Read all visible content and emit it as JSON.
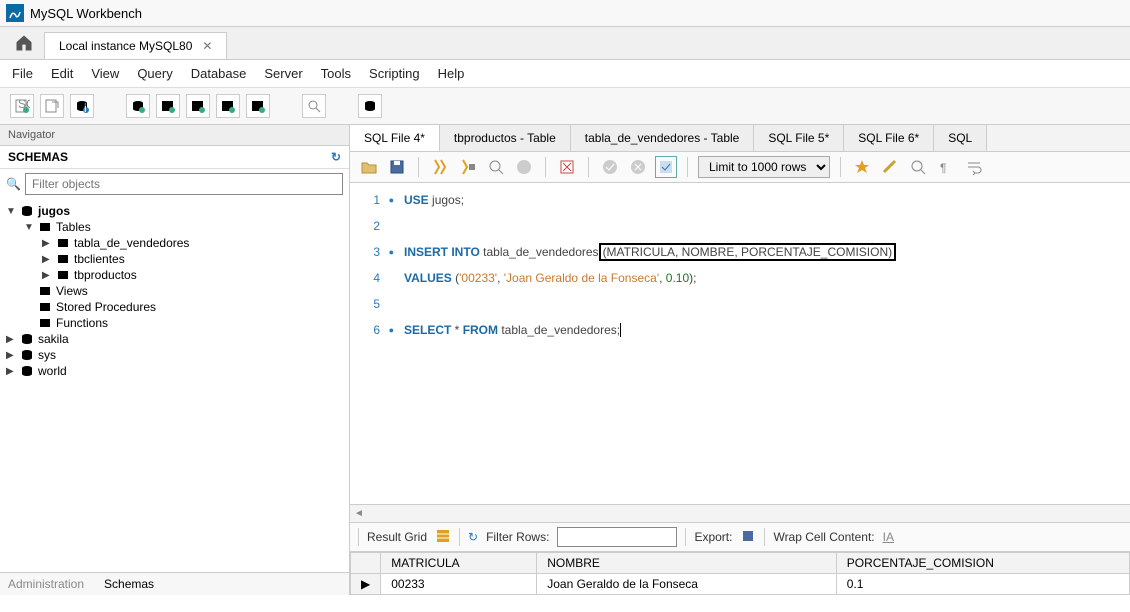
{
  "app_title": "MySQL Workbench",
  "connection_tab": "Local instance MySQL80",
  "menu": [
    "File",
    "Edit",
    "View",
    "Query",
    "Database",
    "Server",
    "Tools",
    "Scripting",
    "Help"
  ],
  "navigator_label": "Navigator",
  "schemas_label": "SCHEMAS",
  "filter_placeholder": "Filter objects",
  "tree": {
    "jugos": "jugos",
    "tables": "Tables",
    "tabla_de_vendedores": "tabla_de_vendedores",
    "tbclientes": "tbclientes",
    "tbproductos": "tbproductos",
    "views": "Views",
    "stored_procedures": "Stored Procedures",
    "functions": "Functions",
    "sakila": "sakila",
    "sys": "sys",
    "world": "world"
  },
  "nav_footer": [
    "Administration",
    "Schemas"
  ],
  "query_tabs": [
    "SQL File 4*",
    "tbproductos - Table",
    "tabla_de_vendedores - Table",
    "SQL File 5*",
    "SQL File 6*",
    "SQL"
  ],
  "limit_label": "Limit to 1000 rows",
  "code": {
    "l1_a": "USE",
    "l1_b": " jugos;",
    "l3_a": "INSERT INTO",
    "l3_b": " tabla_de_vendedores",
    "l3_c": "(MATRICULA, NOMBRE, PORCENTAJE_COMISION)",
    "l4_a": "VALUES",
    "l4_b": " (",
    "l4_c": "'00233'",
    "l4_d": ", ",
    "l4_e": "'Joan Geraldo de la Fonseca'",
    "l4_f": ", ",
    "l4_g": "0.10",
    "l4_h": ");",
    "l6_a": "SELECT",
    "l6_b": " * ",
    "l6_c": "FROM",
    "l6_d": " tabla_de_vendedores;"
  },
  "line_numbers": [
    "1",
    "2",
    "3",
    "4",
    "5",
    "6"
  ],
  "result_grid_label": "Result Grid",
  "filter_rows_label": "Filter Rows:",
  "export_label": "Export:",
  "wrap_label": "Wrap Cell Content:",
  "columns": [
    "MATRICULA",
    "NOMBRE",
    "PORCENTAJE_COMISION"
  ],
  "row1": [
    "00233",
    "Joan Geraldo de la Fonseca",
    "0.1"
  ]
}
